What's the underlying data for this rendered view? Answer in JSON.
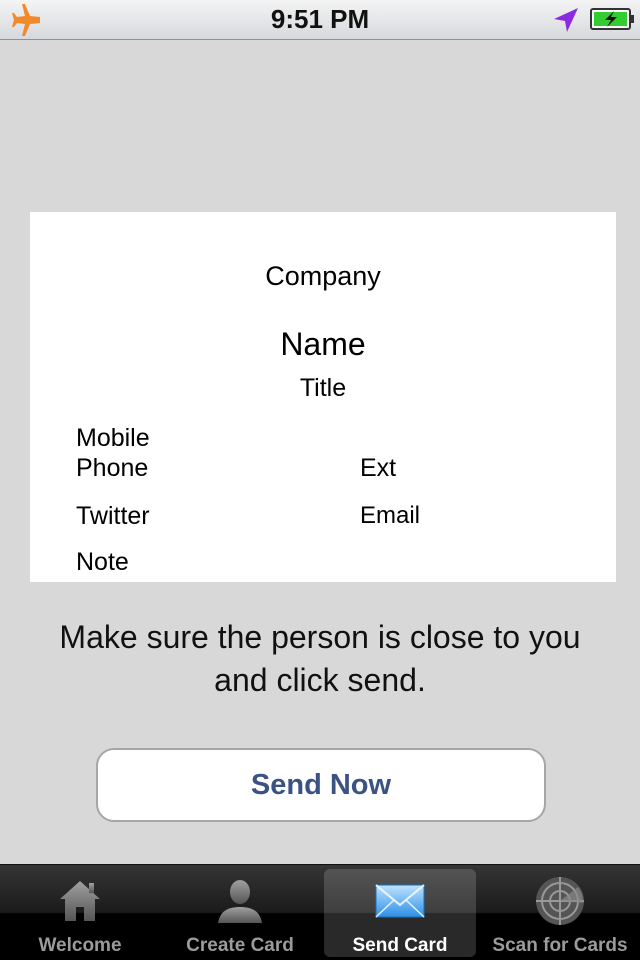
{
  "status_bar": {
    "time": "9:51 PM",
    "icons": [
      "airplane-icon",
      "location-icon",
      "battery-charging-icon"
    ]
  },
  "card": {
    "company": "Company",
    "name": "Name",
    "title": "Title",
    "mobile": "Mobile",
    "phone": "Phone",
    "ext": "Ext",
    "twitter": "Twitter",
    "email": "Email",
    "note": "Note"
  },
  "instructions": "Make sure the person is close to you and click send.",
  "send_button": {
    "label": "Send Now"
  },
  "tab_bar": {
    "selected": "Send Card",
    "tabs": [
      {
        "label": "Welcome",
        "icon": "home-icon"
      },
      {
        "label": "Create Card",
        "icon": "person-icon"
      },
      {
        "label": "Send Card",
        "icon": "envelope-icon"
      },
      {
        "label": "Scan for Cards",
        "icon": "radar-icon"
      }
    ]
  },
  "colors": {
    "background": "#d8d8d8",
    "button_text": "#3a5383",
    "airplane": "#f2892a",
    "battery": "#33cc33"
  }
}
